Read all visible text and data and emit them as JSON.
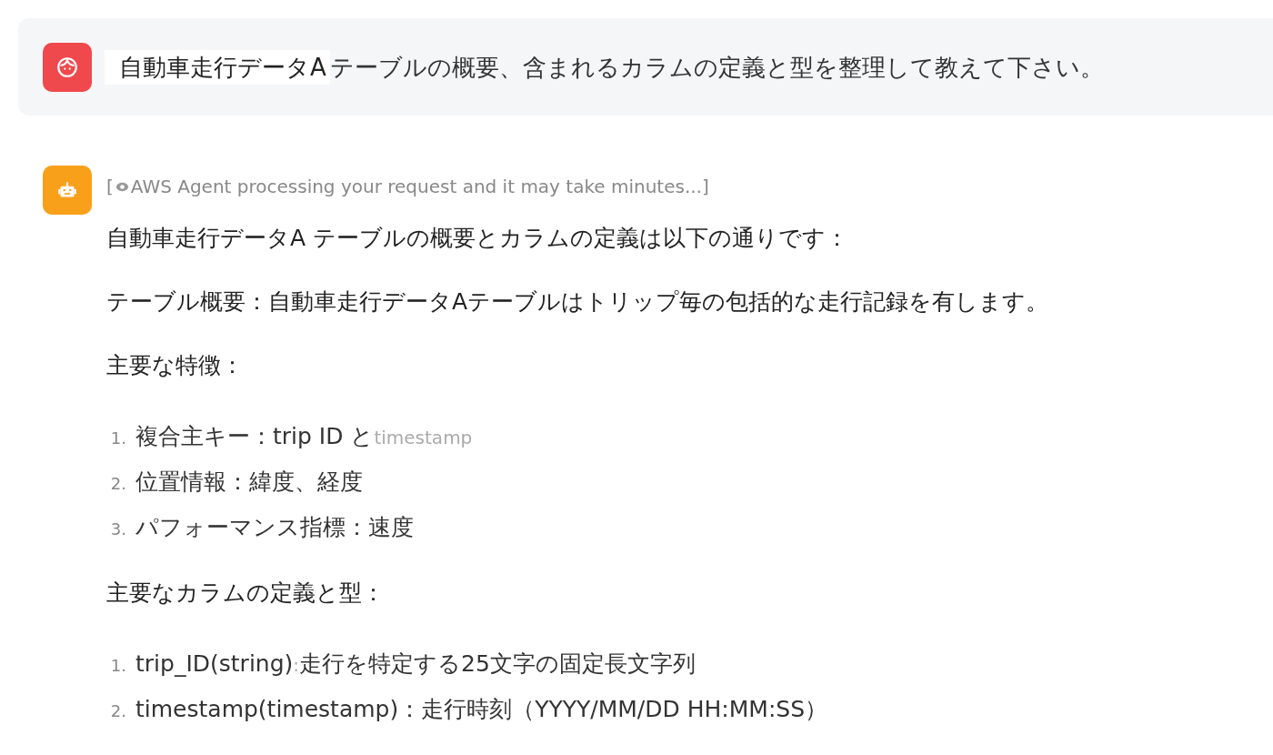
{
  "question": {
    "parts": [
      {
        "text": "自動車走行データA",
        "highlighted": true
      },
      {
        "text": "テーブルの概要、含まれるカラムの定義と型を整理して教えて下さい。",
        "highlighted": false
      }
    ]
  },
  "answer": {
    "status": {
      "open": "[",
      "text": "AWS Agent processing your request and it may take minutes...]"
    },
    "blocks": [
      {
        "kind": "paragraph",
        "text": "自動車走行データA テーブルの概要とカラムの定義は以下の通りです："
      },
      {
        "kind": "paragraph",
        "text": "テーブル概要：自動車走行データAテーブルはトリップ毎の包括的な走行記録を有します。"
      },
      {
        "kind": "paragraph",
        "text": "主要な特徴："
      },
      {
        "kind": "list",
        "items": [
          {
            "number": "1.",
            "parts": [
              {
                "text": "複合主キー：trip  ID と",
                "muted": false
              },
              {
                "text": "timestamp",
                "muted": true
              }
            ]
          },
          {
            "number": "2.",
            "parts": [
              {
                "text": "位置情報：緯度、経度",
                "muted": false
              }
            ]
          },
          {
            "number": "3.",
            "parts": [
              {
                "text": "パフォーマンス指標：速度",
                "muted": false
              }
            ]
          }
        ]
      },
      {
        "kind": "paragraph",
        "text": "主要なカラムの定義と型："
      },
      {
        "kind": "list",
        "items": [
          {
            "number": "1.",
            "parts": [
              {
                "text": "trip_ID(string)",
                "muted": false
              },
              {
                "text": ":",
                "muted": true
              },
              {
                "text": "走行を特定する25文字の固定長文字列",
                "muted": false
              }
            ]
          },
          {
            "number": "2.",
            "parts": [
              {
                "text": "timestamp(timestamp)：走行時刻（YYYY/MM/DD HH:MM:SS）",
                "muted": false
              }
            ]
          }
        ]
      }
    ]
  }
}
